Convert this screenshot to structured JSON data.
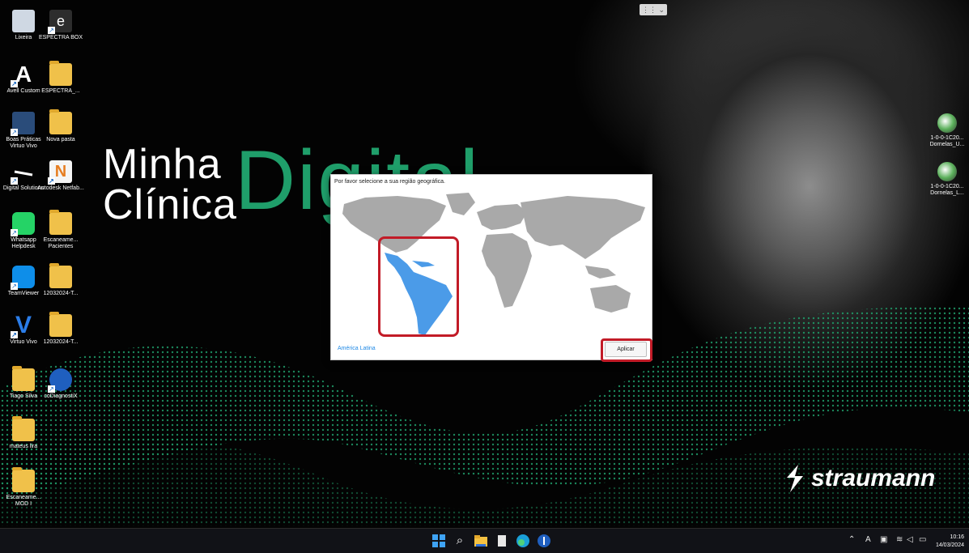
{
  "desktop": {
    "icons": [
      {
        "label": "Lixeira"
      },
      {
        "label": "ESPECTRA BOX"
      },
      {
        "label": "Avell Custom"
      },
      {
        "label": "ESPECTRA_..."
      },
      {
        "label": "Boas Práticas Virtuo Vivo"
      },
      {
        "label": "Nova pasta"
      },
      {
        "label": "Digital Solutions"
      },
      {
        "label": "Autodesk Netfab..."
      },
      {
        "label": "Whatsapp Helpdesk"
      },
      {
        "label": "Escaneame... Pacientes"
      },
      {
        "label": "TeamViewer"
      },
      {
        "label": "12032024-T..."
      },
      {
        "label": "Virtuo Vivo"
      },
      {
        "label": "12032024-T..."
      },
      {
        "label": "Tiago Silva"
      },
      {
        "label": "coDiagnostiX"
      },
      {
        "label": "mateus lira"
      },
      {
        "label": "Escaneame... MOD I"
      }
    ],
    "right_icons": [
      {
        "label": "1-0-0-1C20... Dornelas_U..."
      },
      {
        "label": "1-0-0-1C20... Dornelas_L..."
      }
    ],
    "wallpaper": {
      "title_line1": "Minha",
      "title_line2": "Clínica",
      "title_big": "Digital",
      "brand": "straumann",
      "accent_color": "#1f9e6a"
    }
  },
  "dialog": {
    "title": "Por favor selecione a sua região geográfica.",
    "selected_region": "América Latina",
    "apply_label": "Aplicar",
    "map_colors": {
      "land": "#a9a9a9",
      "selected": "#4b9be8",
      "highlight": "#c21b27"
    }
  },
  "taskbar": {
    "time": "10:16",
    "date": "14/03/2024",
    "tray_lang": "A"
  }
}
